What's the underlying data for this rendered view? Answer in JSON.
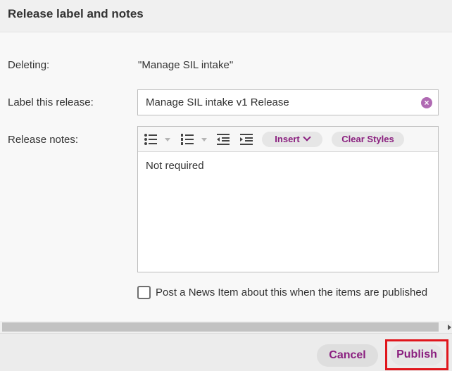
{
  "dialog": {
    "title": "Release label and notes"
  },
  "fields": {
    "deleting_label": "Deleting:",
    "deleting_value": "\"Manage SIL intake\"",
    "release_label_label": "Label this release:",
    "release_label_value": "Manage SIL intake v1 Release",
    "release_notes_label": "Release notes:"
  },
  "editor": {
    "toolbar": {
      "insert_label": "Insert",
      "clear_styles_label": "Clear Styles",
      "icons": [
        "bullet-list-icon",
        "numbered-list-icon",
        "outdent-icon",
        "indent-icon"
      ]
    },
    "content": "Not required"
  },
  "news_item": {
    "label": "Post a News Item about this when the items are published",
    "checked": false
  },
  "footer": {
    "cancel_label": "Cancel",
    "publish_label": "Publish"
  },
  "colors": {
    "accent": "#8a1f7f",
    "highlight_border": "#e0161c",
    "clear_icon": "#b06ab3"
  }
}
